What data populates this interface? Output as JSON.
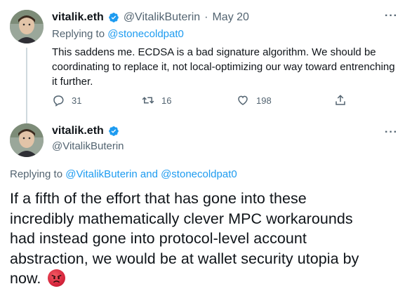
{
  "tweet1": {
    "display_name": "vitalik.eth",
    "handle": "@VitalikButerin",
    "separator": "·",
    "date": "May 20",
    "replying_prefix": "Replying to",
    "replying_handle": "@stonecoldpat0",
    "text_line1": "This saddens me. ECDSA is a bad signature algorithm. We should be",
    "text_line2": "coordinating to replace it, not local-optimizing our way toward entrenching",
    "text_line3": "it further.",
    "replies": "31",
    "retweets": "16",
    "likes": "198",
    "more": "···"
  },
  "tweet2": {
    "display_name": "vitalik.eth",
    "handle": "@VitalikButerin",
    "more": "···",
    "replying_prefix": "Replying to",
    "replying_handles": "@VitalikButerin and @stonecoldpat0",
    "text_line1": "If a fifth of the effort that has gone into these",
    "text_line2": "incredibly mathematically clever MPC workarounds",
    "text_line3": "had instead gone into protocol-level account",
    "text_line4": "abstraction, we would be at wallet security utopia by",
    "text_line5": "now.",
    "emoji": "angry-face-emoji"
  },
  "colors": {
    "link": "#1d9bf0",
    "muted": "#536471",
    "text": "#0f1419",
    "verified": "#1d9bf0"
  }
}
